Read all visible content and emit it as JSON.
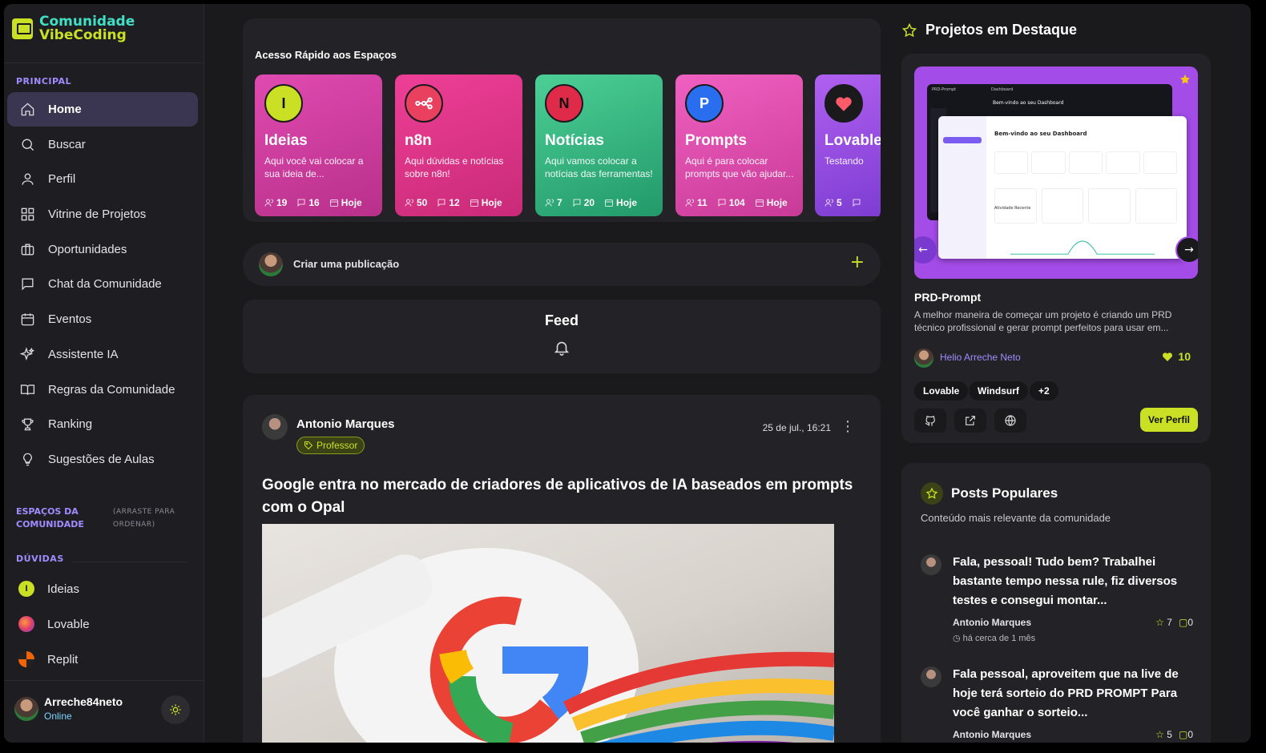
{
  "brand": {
    "line1": "Comunidade",
    "line2": "VibeCoding"
  },
  "sidebar": {
    "section_principal": "PRINCIPAL",
    "items": [
      {
        "label": "Home",
        "icon": "home-icon"
      },
      {
        "label": "Buscar",
        "icon": "search-icon"
      },
      {
        "label": "Perfil",
        "icon": "user-icon"
      },
      {
        "label": "Vitrine de Projetos",
        "icon": "grid-icon"
      },
      {
        "label": "Oportunidades",
        "icon": "briefcase-icon"
      },
      {
        "label": "Chat da Comunidade",
        "icon": "chat-icon"
      },
      {
        "label": "Eventos",
        "icon": "calendar-icon"
      },
      {
        "label": "Assistente IA",
        "icon": "sparkles-icon"
      },
      {
        "label": "Regras da Comunidade",
        "icon": "book-icon"
      },
      {
        "label": "Ranking",
        "icon": "trophy-icon"
      },
      {
        "label": "Sugestões de Aulas",
        "icon": "lightbulb-icon"
      }
    ],
    "espacos_label": "ESPAÇOS DA COMUNIDADE",
    "espacos_hint": "(ARRASTE PARA ORDENAR)",
    "duvidas_label": "DÚVIDAS",
    "spaces": [
      {
        "label": "Ideias",
        "letter": "I",
        "color": "#c9e024"
      },
      {
        "label": "Lovable",
        "letter": "",
        "color": "#e0406a"
      },
      {
        "label": "Replit",
        "letter": "",
        "color": "#f26207"
      }
    ],
    "user": {
      "name": "Arreche84neto",
      "status": "Online"
    }
  },
  "quick_access": {
    "title": "Acesso Rápido aos Espaços",
    "cards": [
      {
        "letter": "I",
        "name": "Ideias",
        "desc": "Aqui você vai colocar a sua ideia de...",
        "members": "19",
        "posts": "16",
        "date": "Hoje",
        "badge_color": "#c9e024",
        "bg": "#d63aa0"
      },
      {
        "letter": "",
        "name": "n8n",
        "desc": "Aqui dúvidas e notícias sobre n8n!",
        "members": "50",
        "posts": "12",
        "date": "Hoje",
        "badge_color": "#e8405e",
        "bg": "#e83a8e"
      },
      {
        "letter": "N",
        "name": "Notícias",
        "desc": "Aqui vamos colocar a notícias das ferramentas!",
        "members": "7",
        "posts": "20",
        "date": "Hoje",
        "badge_color": "#e02a4a",
        "bg": "#35b882"
      },
      {
        "letter": "P",
        "name": "Prompts",
        "desc": "Aqui é para colocar prompts que vão ajudar...",
        "members": "11",
        "posts": "104",
        "date": "Hoje",
        "badge_color": "#2a6ef0",
        "bg": "#e04aa8"
      },
      {
        "letter": "",
        "name": "Lovable",
        "desc": "Testando",
        "members": "5",
        "posts": "",
        "date": "",
        "badge_color": "#1a1a1d",
        "bg": "#9a4ad8"
      }
    ]
  },
  "create_post": {
    "label": "Criar uma publicação"
  },
  "feed": {
    "title": "Feed"
  },
  "post": {
    "author": "Antonio Marques",
    "role": "Professor",
    "date": "25 de jul., 16:21",
    "title": "Google entra no mercado de criadores de aplicativos de IA baseados em prompts com o Opal"
  },
  "featured": {
    "title": "Projetos em Destaque",
    "name": "PRD-Prompt",
    "desc": "A melhor maneira de começar um projeto é criando um PRD técnico profissional e gerar prompt perfeitos para usar em...",
    "author": "Helio Arreche Neto",
    "likes": "10",
    "tags": [
      "Lovable",
      "Windsurf",
      "+2"
    ],
    "button": "Ver Perfil",
    "preview": {
      "brand": "PRD-Prompt",
      "heading": "Dashboard",
      "welcome": "Bem-vindo ao seu Dashboard",
      "section": "Atividade Recente"
    }
  },
  "popular": {
    "title": "Posts Populares",
    "subtitle": "Conteúdo mais relevante da comunidade",
    "posts": [
      {
        "title": "Fala, pessoal! Tudo bem? Trabalhei bastante tempo nessa rule, fiz diversos testes e consegui montar...",
        "author": "Antonio Marques",
        "time": "há cerca de 1 mês",
        "stars": "7",
        "comments": "0"
      },
      {
        "title": "Fala pessoal, aproveitem que na live de hoje terá sorteio do PRD PROMPT Para você ganhar o sorteio...",
        "author": "Antonio Marques",
        "time": "",
        "stars": "5",
        "comments": "0"
      }
    ]
  },
  "colors": {
    "accent": "#c9e024",
    "purple": "#a18cff",
    "bg": "#1a1a1d",
    "card": "#232327"
  }
}
